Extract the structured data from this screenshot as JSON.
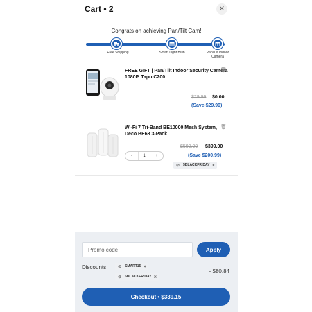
{
  "header": {
    "title": "Cart • 2",
    "close_icon": "close-icon",
    "close_glyph": "×"
  },
  "progress": {
    "message": "Congrats on achieving Pan/Tilt Cam!",
    "fill_fraction": 1.0,
    "milestones": [
      {
        "label": "Free Shipping",
        "icon": "truck-icon"
      },
      {
        "label": "Smart Light Bulb",
        "icon": "gift-icon"
      },
      {
        "label": "Pan/Tilt Indoor Camera",
        "icon": "gift-icon"
      }
    ]
  },
  "items": [
    {
      "name": "FREE GIFT | Pan/Tilt Indoor Security Camera 1080P, Tapo C200",
      "original_price": "$29.99",
      "price": "$0.00",
      "savings": "(Save $29.99)",
      "trash_icon": "trash-icon",
      "trash_glyph": "🗑"
    },
    {
      "name": "Wi-Fi 7 Tri-Band BE10000 Mesh System, Deco BE63 3-Pack",
      "original_price": "$599.99",
      "price": "$399.00",
      "savings": "(Save $200.99)",
      "quantity": "1",
      "dec_glyph": "-",
      "inc_glyph": "+",
      "coupon": "5BLACKFRIDAY",
      "trash_icon": "trash-icon",
      "trash_glyph": "🗑"
    }
  ],
  "footer": {
    "promo_placeholder": "Promo code",
    "apply_label": "Apply",
    "discounts_label": "Discounts",
    "discount_codes": [
      "SMART15",
      "5BLACKFRIDAY"
    ],
    "discount_total": "- $80.84",
    "checkout_label": "Checkout • $339.15"
  },
  "chip_glyphs": {
    "tag": "⊘",
    "remove": "×"
  },
  "colors": {
    "accent": "#1f5fb4",
    "footer_bg": "#eceff3",
    "savings": "#1f5fb4"
  }
}
